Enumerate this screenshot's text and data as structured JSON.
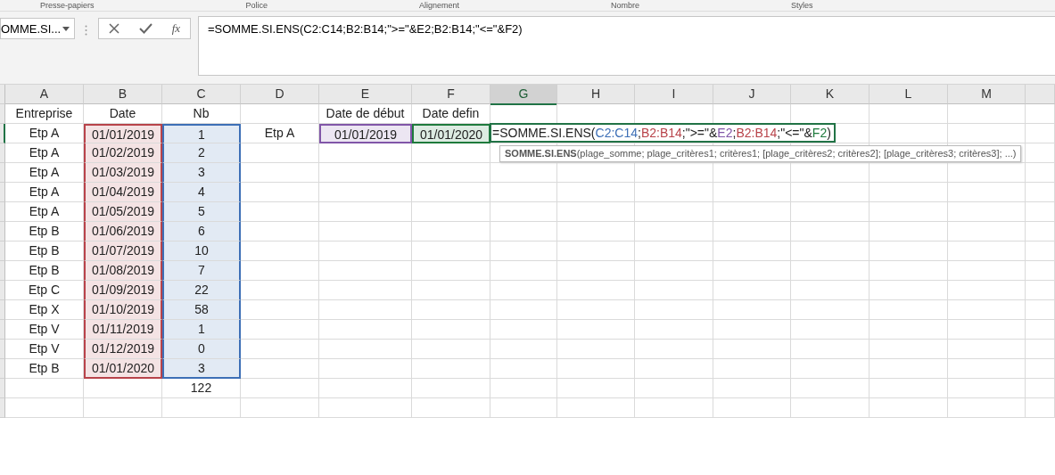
{
  "ribbon_groups": [
    {
      "label": "Presse-papiers"
    },
    {
      "label": "Police"
    },
    {
      "label": "Alignement"
    },
    {
      "label": "Nombre"
    },
    {
      "label": "Styles"
    }
  ],
  "name_box": {
    "value": "OMME.SI..."
  },
  "formula_bar": {
    "fx_label": "fx",
    "value": "=SOMME.SI.ENS(C2:C14;B2:B14;\">=\"&E2;B2:B14;\"<=\"&F2)"
  },
  "columns": [
    {
      "label": "A",
      "selected": false
    },
    {
      "label": "B",
      "selected": false
    },
    {
      "label": "C",
      "selected": false
    },
    {
      "label": "D",
      "selected": false
    },
    {
      "label": "E",
      "selected": false
    },
    {
      "label": "F",
      "selected": false
    },
    {
      "label": "G",
      "selected": true
    },
    {
      "label": "H",
      "selected": false
    },
    {
      "label": "I",
      "selected": false
    },
    {
      "label": "J",
      "selected": false
    },
    {
      "label": "K",
      "selected": false
    },
    {
      "label": "L",
      "selected": false
    },
    {
      "label": "M",
      "selected": false
    }
  ],
  "rows": [
    {
      "A": {
        "text": "Entreprise"
      },
      "B": {
        "text": "Date"
      },
      "C": {
        "text": "Nb"
      },
      "E": {
        "text": "Date de début"
      },
      "F": {
        "text": "Date defin"
      }
    },
    {
      "A": {
        "text": "Etp A"
      },
      "B": {
        "text": "01/01/2019",
        "color": "#b8434a"
      },
      "C": {
        "text": "1",
        "color": "#3d6fb6"
      },
      "D": {
        "text": "Etp A"
      },
      "E": {
        "text": "01/01/2019",
        "color": "#8156a8"
      },
      "F": {
        "text": "01/01/2020",
        "color": "#1e7a3c"
      },
      "G": {
        "kind": "formula",
        "segments": [
          {
            "text": "=SOMME.SI.ENS("
          },
          {
            "text": "C2:C14",
            "color": "#3d6fb6"
          },
          {
            "text": ";"
          },
          {
            "text": "B2:B14",
            "color": "#b8434a"
          },
          {
            "text": ";\">=\"&"
          },
          {
            "text": "E2",
            "color": "#8156a8"
          },
          {
            "text": ";"
          },
          {
            "text": "B2:B14",
            "color": "#b8434a"
          },
          {
            "text": ";\"<=\"&"
          },
          {
            "text": "F2",
            "color": "#1e7a3c"
          },
          {
            "text": ")"
          }
        ]
      }
    },
    {
      "A": {
        "text": "Etp A"
      },
      "B": {
        "text": "01/02/2019",
        "color": "#b8434a"
      },
      "C": {
        "text": "2",
        "color": "#3d6fb6"
      }
    },
    {
      "A": {
        "text": "Etp A"
      },
      "B": {
        "text": "01/03/2019",
        "color": "#b8434a"
      },
      "C": {
        "text": "3",
        "color": "#3d6fb6"
      }
    },
    {
      "A": {
        "text": "Etp A"
      },
      "B": {
        "text": "01/04/2019",
        "color": "#b8434a"
      },
      "C": {
        "text": "4",
        "color": "#3d6fb6"
      }
    },
    {
      "A": {
        "text": "Etp A"
      },
      "B": {
        "text": "01/05/2019",
        "color": "#b8434a"
      },
      "C": {
        "text": "5",
        "color": "#3d6fb6"
      }
    },
    {
      "A": {
        "text": "Etp B"
      },
      "B": {
        "text": "01/06/2019",
        "color": "#b8434a"
      },
      "C": {
        "text": "6",
        "color": "#3d6fb6"
      }
    },
    {
      "A": {
        "text": "Etp B"
      },
      "B": {
        "text": "01/07/2019",
        "color": "#b8434a"
      },
      "C": {
        "text": "10",
        "color": "#3d6fb6"
      }
    },
    {
      "A": {
        "text": "Etp B"
      },
      "B": {
        "text": "01/08/2019",
        "color": "#b8434a"
      },
      "C": {
        "text": "7",
        "color": "#3d6fb6"
      }
    },
    {
      "A": {
        "text": "Etp C"
      },
      "B": {
        "text": "01/09/2019",
        "color": "#b8434a"
      },
      "C": {
        "text": "22",
        "color": "#3d6fb6"
      }
    },
    {
      "A": {
        "text": "Etp X"
      },
      "B": {
        "text": "01/10/2019",
        "color": "#b8434a"
      },
      "C": {
        "text": "58",
        "color": "#3d6fb6"
      }
    },
    {
      "A": {
        "text": "Etp V"
      },
      "B": {
        "text": "01/11/2019",
        "color": "#b8434a"
      },
      "C": {
        "text": "1",
        "color": "#3d6fb6"
      }
    },
    {
      "A": {
        "text": "Etp V"
      },
      "B": {
        "text": "01/12/2019",
        "color": "#b8434a"
      },
      "C": {
        "text": "0",
        "color": "#3d6fb6"
      }
    },
    {
      "A": {
        "text": "Etp B"
      },
      "B": {
        "text": "01/01/2020",
        "color": "#b8434a"
      },
      "C": {
        "text": "3",
        "color": "#3d6fb6"
      }
    },
    {
      "C": {
        "text": "122"
      }
    },
    {}
  ],
  "tooltip": {
    "text": "**SOMME.SI.ENS**(plage_somme; plage_critères1; critères1; [plage_critères2; critères2]; [plage_critères3; critères3]; ...)"
  }
}
